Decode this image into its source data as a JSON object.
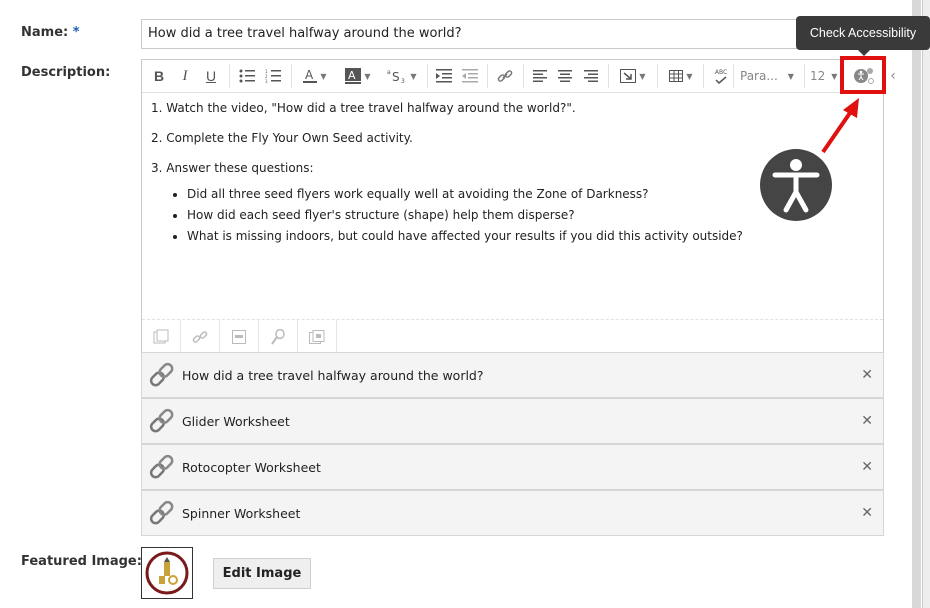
{
  "form": {
    "name_label": "Name:",
    "required_mark": "*",
    "name_value": "How did a tree travel halfway around the world?",
    "description_label": "Description:",
    "featured_label": "Featured Image:",
    "edit_image_label": "Edit Image"
  },
  "toolbar": {
    "bold": "B",
    "italic": "I",
    "underline": "U",
    "paragraph": "Para...",
    "font_size": "12",
    "spellcheck": "ABC"
  },
  "tooltip": {
    "text": "Check Accessibility"
  },
  "content": {
    "p1": "1. Watch the video, \"How did a tree travel halfway around the world?\".",
    "p2": "2. Complete the Fly Your Own Seed activity.",
    "p3": "3. Answer these questions:",
    "bullets": [
      "Did all three seed flyers work equally well at avoiding the Zone of Darkness?",
      "How did each seed flyer's structure (shape) help them disperse?",
      "What is missing indoors, but could have affected your results if you did this activity outside?"
    ]
  },
  "attachments": [
    {
      "title": "How did a tree travel halfway around the world?"
    },
    {
      "title": "Glider Worksheet"
    },
    {
      "title": "Rotocopter Worksheet"
    },
    {
      "title": "Spinner Worksheet"
    }
  ],
  "colors": {
    "highlight": "#e01010",
    "tooltip_bg": "#3a3a3a",
    "required": "#1a5fb4"
  },
  "icons": {
    "accessibility": "accessibility-icon",
    "link": "link-icon",
    "remove": "close-icon"
  }
}
